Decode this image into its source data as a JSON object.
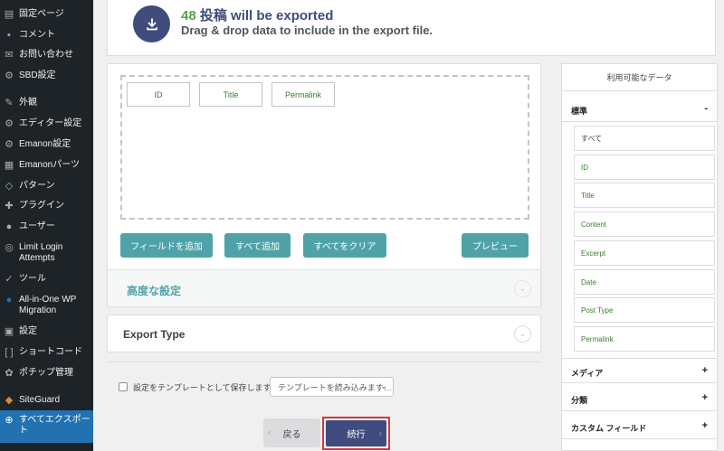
{
  "sidebar": {
    "items": [
      {
        "label": "固定ページ",
        "icon": "pages-icon"
      },
      {
        "label": "コメント",
        "icon": "comments-icon"
      },
      {
        "label": "お問い合わせ",
        "icon": "mail-icon"
      },
      {
        "label": "SBD設定",
        "icon": "gear-icon"
      },
      {
        "label": "外観",
        "icon": "appearance-icon"
      },
      {
        "label": "エディター設定",
        "icon": "gear-icon"
      },
      {
        "label": "Emanon設定",
        "icon": "gear-icon"
      },
      {
        "label": "Emanonパーツ",
        "icon": "grid-icon"
      },
      {
        "label": "パターン",
        "icon": "pattern-icon"
      },
      {
        "label": "プラグイン",
        "icon": "plugin-icon"
      },
      {
        "label": "ユーザー",
        "icon": "user-icon"
      },
      {
        "label": "Limit Login Attempts",
        "icon": "fingerprint-icon"
      },
      {
        "label": "ツール",
        "icon": "wrench-icon"
      },
      {
        "label": "All-in-One WP Migration",
        "icon": "migration-icon"
      },
      {
        "label": "設定",
        "icon": "settings-icon"
      },
      {
        "label": "ショートコード",
        "icon": "brackets-icon"
      },
      {
        "label": "ポチップ管理",
        "icon": "paw-icon"
      },
      {
        "label": "SiteGuard",
        "icon": "shield-icon"
      },
      {
        "label": "すべてエクスポート",
        "icon": "export-icon"
      }
    ]
  },
  "header": {
    "count": "48",
    "title_rest": "投稿 will be exported",
    "subtitle": "Drag & drop data to include in the export file."
  },
  "drop_zone": {
    "chips": [
      "ID",
      "Title",
      "Permalink"
    ]
  },
  "buttons": {
    "add_field": "フィールドを追加",
    "add_all": "すべて追加",
    "clear_all": "すべてをクリア",
    "preview": "プレビュー",
    "back": "戻る",
    "next": "続行"
  },
  "advanced": {
    "label": "高度な設定"
  },
  "export_type": {
    "label": "Export Type"
  },
  "template": {
    "save_label": "設定をテンプレートとして保存します。",
    "select_placeholder": "テンプレートを読み込みます…"
  },
  "right_panel": {
    "title": "利用可能なデータ",
    "standard": {
      "label": "標準",
      "toggle": "-",
      "items": [
        "すべて",
        "ID",
        "Title",
        "Content",
        "Excerpt",
        "Date",
        "Post Type",
        "Permalink"
      ]
    },
    "groups": [
      {
        "label": "メディア",
        "toggle": "+"
      },
      {
        "label": "分類",
        "toggle": "+"
      },
      {
        "label": "カスタム フィールド",
        "toggle": "+"
      }
    ]
  },
  "colors": {
    "sidebar_bg": "#1d2327",
    "sidebar_active": "#2271b1",
    "brand_navy": "#3f4c7d",
    "count_green": "#53a642",
    "teal": "#4fa3a8",
    "highlight_red": "#d63638"
  }
}
